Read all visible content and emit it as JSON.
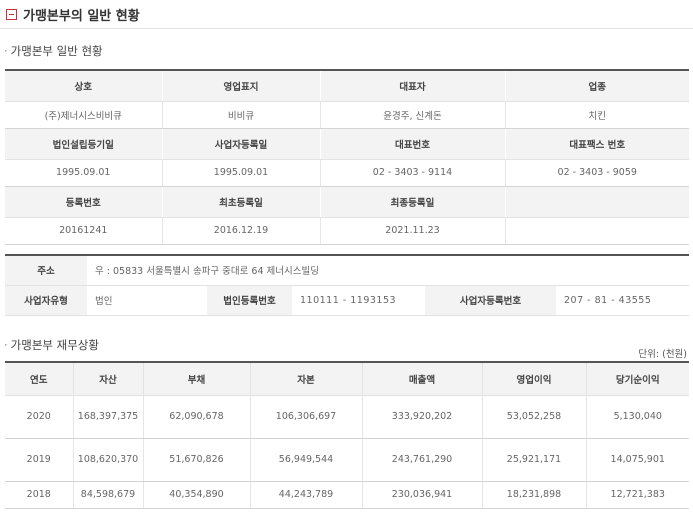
{
  "page_title": "가맹본부의 일반 현황",
  "general": {
    "section_title": "가맹본부 일반 현황",
    "headers_row1": [
      "상호",
      "영업표지",
      "대표자",
      "업종"
    ],
    "values_row1": [
      "(주)제너시스비비큐",
      "비비큐",
      "윤경주, 신계돈",
      "치킨"
    ],
    "headers_row2": [
      "법인설립등기일",
      "사업자등록일",
      "대표번호",
      "대표팩스 번호"
    ],
    "values_row2": [
      "1995.09.01",
      "1995.09.01",
      "02 - 3403 - 9114",
      "02 - 3403 - 9059"
    ],
    "headers_row3": [
      "등록번호",
      "최초등록일",
      "최종등록일",
      ""
    ],
    "values_row3": [
      "20161241",
      "2016.12.19",
      "2021.11.23",
      ""
    ]
  },
  "address": {
    "address_label": "주소",
    "address_value": "우 : 05833 서울특별시 송파구 중대로 64 제너시스빌딩",
    "biz_type_label": "사업자유형",
    "biz_type_value": "법인",
    "corp_reg_label": "법인등록번호",
    "corp_reg_value": "110111 - 1193153",
    "biz_reg_label": "사업자등록번호",
    "biz_reg_value": "207 - 81 - 43555"
  },
  "finance": {
    "section_title": "가맹본부 재무상황",
    "unit_note": "단위: (천원)",
    "headers": [
      "연도",
      "자산",
      "부채",
      "자본",
      "매출액",
      "영업이익",
      "당기순이익"
    ],
    "rows": [
      [
        "2020",
        "168,397,375",
        "62,090,678",
        "106,306,697",
        "333,920,202",
        "53,052,258",
        "5,130,040"
      ],
      [
        "2019",
        "108,620,370",
        "51,670,826",
        "56,949,544",
        "243,761,290",
        "25,921,171",
        "14,075,901"
      ],
      [
        "2018",
        "84,598,679",
        "40,354,890",
        "44,243,789",
        "230,036,941",
        "18,231,898",
        "12,721,383"
      ]
    ]
  }
}
